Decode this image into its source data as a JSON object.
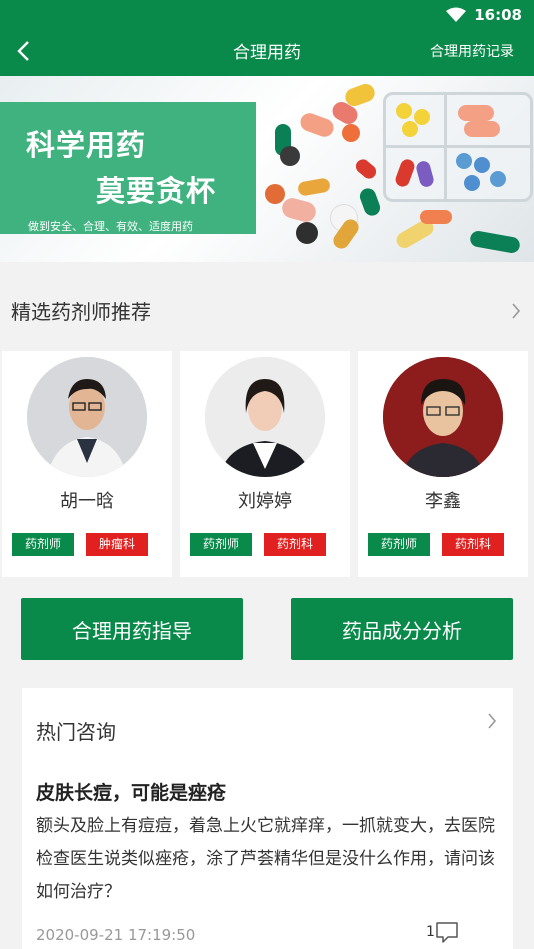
{
  "status_bar": {
    "time": "16:08"
  },
  "nav": {
    "title": "合理用药",
    "right_link": "合理用药记录"
  },
  "banner": {
    "line1": "科学用药",
    "line2": "莫要贪杯",
    "line3": "做到安全、合理、有效、适度用药"
  },
  "section": {
    "title": "精选药剂师推荐"
  },
  "pharmacists": [
    {
      "name": "胡一晗",
      "role": "药剂师",
      "dept": "肿瘤科"
    },
    {
      "name": "刘婷婷",
      "role": "药剂师",
      "dept": "药剂科"
    },
    {
      "name": "李鑫",
      "role": "药剂师",
      "dept": "药剂科"
    }
  ],
  "actions": {
    "guide": "合理用药指导",
    "analysis": "药品成分分析"
  },
  "consult": {
    "title": "热门咨询",
    "question_title": "皮肤长痘，可能是痤疮",
    "question_body": "额头及脸上有痘痘，着急上火它就痒痒，一抓就变大，去医院检查医生说类似痤疮，涂了芦荟精华但是没什么作用，请问该如何治疗？",
    "date": "2020-09-21 17:19:50",
    "reply_count": "1"
  },
  "colors": {
    "primary": "#0a8a4a",
    "tag_red": "#e0211f",
    "banner_green": "#3fb27f"
  },
  "icons": [
    "wifi-icon",
    "back-arrow-icon",
    "chevron-right-icon",
    "comment-icon"
  ]
}
